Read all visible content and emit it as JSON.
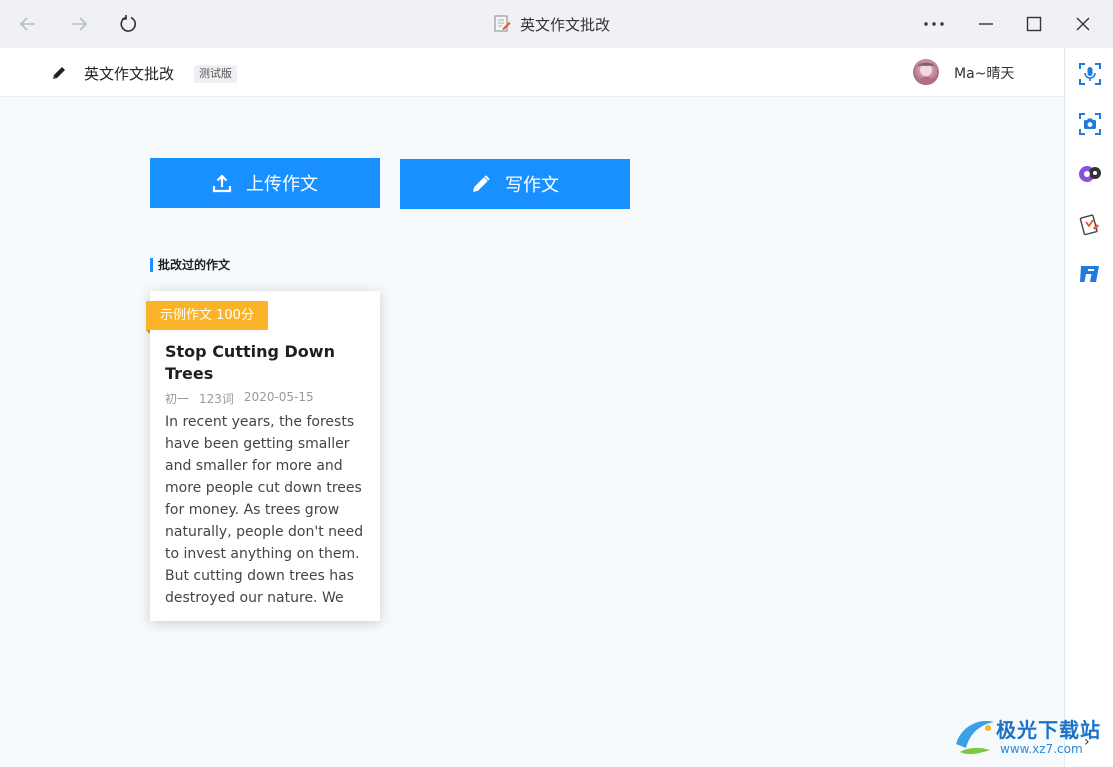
{
  "window": {
    "title": "英文作文批改",
    "icons": {
      "back": "arrow-left-icon",
      "forward": "arrow-right-icon",
      "reload": "reload-icon",
      "more": "more-dots-icon",
      "minimize": "minimize-icon",
      "maximize": "maximize-icon",
      "close": "close-icon"
    }
  },
  "header": {
    "title": "英文作文批改",
    "badge": "测试版",
    "username": "Ma~晴天"
  },
  "main": {
    "upload_label": "上传作文",
    "write_label": "写作文",
    "section_title": "批改过的作文",
    "cards": [
      {
        "tag": "示例作文 100分",
        "title": "Stop Cutting Down Trees",
        "grade": "初一",
        "words": "123词",
        "date": "2020-05-15",
        "excerpt": "In recent years, the forests have been getting smaller and smaller for more and more people cut down trees for money. As trees grow naturally, people don't need to invest anything on them. But cutting down trees has destroyed our nature. We"
      }
    ]
  },
  "sidebar": {
    "items": [
      "voice-scan-icon",
      "camera-scan-icon",
      "assistant-icon",
      "essay-card-icon",
      "app-logo-icon"
    ],
    "expand": "›"
  },
  "watermark": {
    "title": "极光下载站",
    "url": "www.xz7.com"
  },
  "colors": {
    "accent": "#1890ff",
    "tag": "#fbb42a",
    "background": "#f7fafd"
  }
}
